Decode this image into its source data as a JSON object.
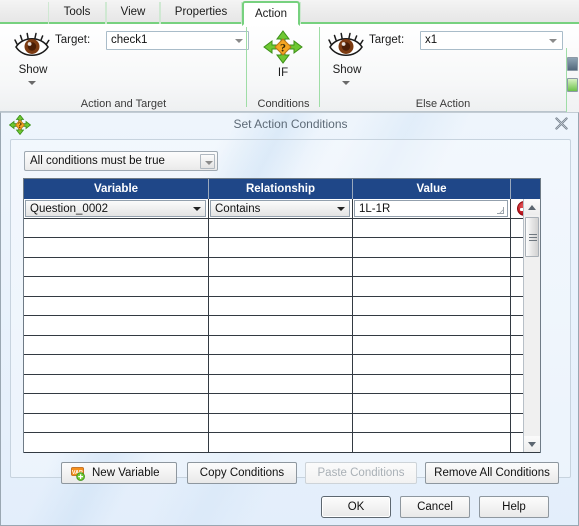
{
  "ribbon": {
    "tabs": [
      {
        "label": "Tools",
        "active": false
      },
      {
        "label": "View",
        "active": false
      },
      {
        "label": "Properties",
        "active": false
      },
      {
        "label": "Action",
        "active": true
      }
    ],
    "groups": [
      {
        "label": "Action and Target"
      },
      {
        "label": "Conditions"
      },
      {
        "label": "Else Action"
      }
    ],
    "action_and_target": {
      "icon": "eye-icon",
      "show_label": "Show",
      "target_label": "Target:",
      "target_value": "check1"
    },
    "conditions": {
      "icon": "if-arrows-question-icon",
      "if_label": "IF"
    },
    "else_action": {
      "icon": "eye-icon",
      "show_label": "Show",
      "target_label": "Target:",
      "target_value": "x1"
    }
  },
  "dialog": {
    "icon": "move-question-icon",
    "title": "Set Action Conditions",
    "close_label": "✖",
    "logic_select": {
      "value": "All conditions must be true"
    },
    "table": {
      "columns": [
        "Variable",
        "Relationship",
        "Value"
      ],
      "rows": [
        {
          "variable": "Question_0002",
          "relationship": "Contains",
          "value": "1L-1R",
          "filled": true
        }
      ],
      "empty_row_count": 12
    },
    "scrollbar": {
      "up_arrow": "scroll-up-arrow",
      "down_arrow": "scroll-down-arrow"
    },
    "tool_buttons": [
      {
        "label": "New Variable",
        "icon": "var-tag-icon",
        "disabled": false
      },
      {
        "label": "Copy Conditions",
        "disabled": false
      },
      {
        "label": "Paste Conditions",
        "disabled": true
      },
      {
        "label": "Remove All Conditions",
        "disabled": false
      }
    ],
    "footer_buttons": [
      {
        "label": "OK",
        "default": true
      },
      {
        "label": "Cancel",
        "default": false
      },
      {
        "label": "Help",
        "default": false
      }
    ]
  },
  "colors": {
    "tab_accent": "#77d17f",
    "table_header": "#1f4788",
    "delete_button": "#b60d16",
    "dialog_bg": "#e9f1fa"
  }
}
